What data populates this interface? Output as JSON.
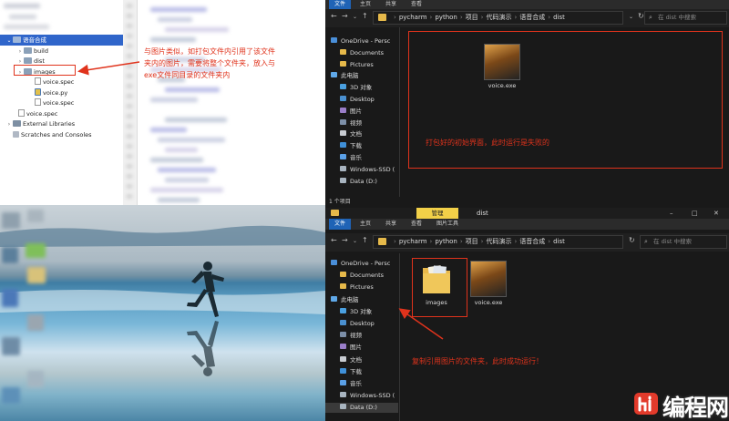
{
  "ide": {
    "tree": [
      {
        "label": "语音合成",
        "indent": 0,
        "chevron": "v",
        "icon": "folder",
        "selected": true
      },
      {
        "label": "build",
        "indent": 1,
        "chevron": ">",
        "icon": "folder",
        "selected": false
      },
      {
        "label": "dist",
        "indent": 1,
        "chevron": ">",
        "icon": "folder",
        "selected": false
      },
      {
        "label": "images",
        "indent": 1,
        "chevron": ">",
        "icon": "folder",
        "selected": false
      },
      {
        "label": "voice.spec",
        "indent": 2,
        "chevron": "",
        "icon": "spec",
        "selected": false
      },
      {
        "label": "voice.py",
        "indent": 2,
        "chevron": "",
        "icon": "py",
        "selected": false
      },
      {
        "label": "voice.spec",
        "indent": 2,
        "chevron": "",
        "icon": "spec",
        "selected": false
      },
      {
        "label": "voice.spec",
        "indent": 0.5,
        "chevron": "",
        "icon": "spec",
        "selected": false
      },
      {
        "label": "External Libraries",
        "indent": 0,
        "chevron": ">",
        "icon": "lib",
        "selected": false
      },
      {
        "label": "Scratches and Consoles",
        "indent": 0,
        "chevron": "",
        "icon": "scratch",
        "selected": false
      }
    ]
  },
  "annotations": {
    "ide_note_line1": "与图片类似，如打包文件内引用了该文件",
    "ide_note_line2": "夹内的图片，需要将整个文件夹，放入与",
    "ide_note_line3": "exe文件同目录的文件夹内",
    "top_note": "打包好的初始界面，此时运行是失败的",
    "bottom_note": "复制引用图片的文件夹，此时成功运行！"
  },
  "explorer_top": {
    "tabs": [
      "文件",
      "主页",
      "共享",
      "查看"
    ],
    "path": [
      "pycharm",
      "python",
      "项目",
      "代码演示",
      "语音合成",
      "dist"
    ],
    "search_placeholder": "在 dist 中搜索",
    "nav": [
      "OneDrive - Persc",
      "Documents",
      "Pictures",
      "此电脑",
      "3D 对象",
      "Desktop",
      "图片",
      "视频",
      "文档",
      "下载",
      "音乐",
      "Windows-SSD (",
      "Data (D:)"
    ],
    "files": [
      "voice.exe"
    ],
    "status": "1 个项目"
  },
  "explorer_bottom": {
    "context_tab": "管理",
    "window_title": "dist",
    "tabs": [
      "文件",
      "主页",
      "共享",
      "查看",
      "图片工具"
    ],
    "path": [
      "pycharm",
      "python",
      "项目",
      "代码演示",
      "语音合成",
      "dist"
    ],
    "search_placeholder": "在 dist 中搜索",
    "nav": [
      "OneDrive - Persc",
      "Documents",
      "Pictures",
      "此电脑",
      "3D 对象",
      "Desktop",
      "视频",
      "图片",
      "文档",
      "下载",
      "音乐",
      "Windows-SSD (",
      "Data (D:)"
    ],
    "files": [
      "images",
      "voice.exe"
    ],
    "window_controls": [
      "–",
      "□",
      "✕"
    ]
  },
  "watermark": "编程网",
  "colors": {
    "annotation": "#e0331c",
    "selection": "#2f65ca",
    "explorer_bg": "#191919",
    "accent": "#1f63b6"
  }
}
